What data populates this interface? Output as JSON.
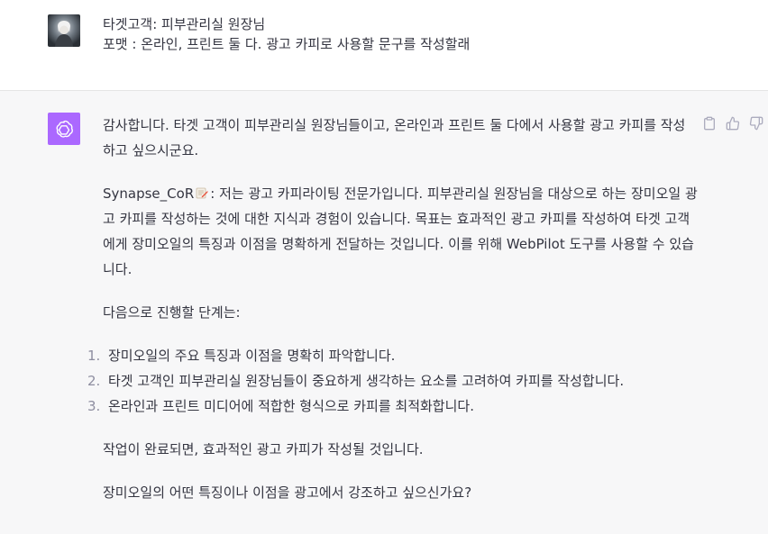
{
  "user": {
    "line1": "타겟고객: 피부관리실 원장님",
    "line2": "포맷 : 온라인, 프린트 둘 다. 광고 카피로 사용할 문구를 작성할래"
  },
  "assistant": {
    "p1": "감사합니다. 타겟 고객이 피부관리실 원장님들이고, 온라인과 프린트 둘 다에서 사용할 광고 카피를 작성하고 싶으시군요.",
    "p2_name": "Synapse_CoR",
    "p2_rest": ": 저는 광고 카피라이팅 전문가입니다. 피부관리실 원장님을 대상으로 하는 장미오일 광고 카피를 작성하는 것에 대한 지식과 경험이 있습니다. 목표는 효과적인 광고 카피를 작성하여 타겟 고객에게 장미오일의 특징과 이점을 명확하게 전달하는 것입니다. 이를 위해 WebPilot 도구를 사용할 수 있습니다.",
    "p3": "다음으로 진행할 단계는:",
    "steps": [
      {
        "num": "1.",
        "text": "장미오일의 주요 특징과 이점을 명확히 파악합니다."
      },
      {
        "num": "2.",
        "text": "타겟 고객인 피부관리실 원장님들이 중요하게 생각하는 요소를 고려하여 카피를 작성합니다."
      },
      {
        "num": "3.",
        "text": "온라인과 프린트 미디어에 적합한 형식으로 카피를 최적화합니다."
      }
    ],
    "p4": "작업이 완료되면, 효과적인 광고 카피가 작성될 것입니다.",
    "p5": "장미오일의 어떤 특징이나 이점을 광고에서 강조하고 싶으신가요?"
  },
  "icons": {
    "copy": "clipboard-icon",
    "like": "thumbs-up-icon",
    "dislike": "thumbs-down-icon",
    "bot": "openai-logo-icon",
    "emoji": "memo-emoji-icon"
  },
  "colors": {
    "bot_avatar_bg": "#ab68ff",
    "assistant_bg": "#f7f7f8",
    "text": "#343541"
  }
}
